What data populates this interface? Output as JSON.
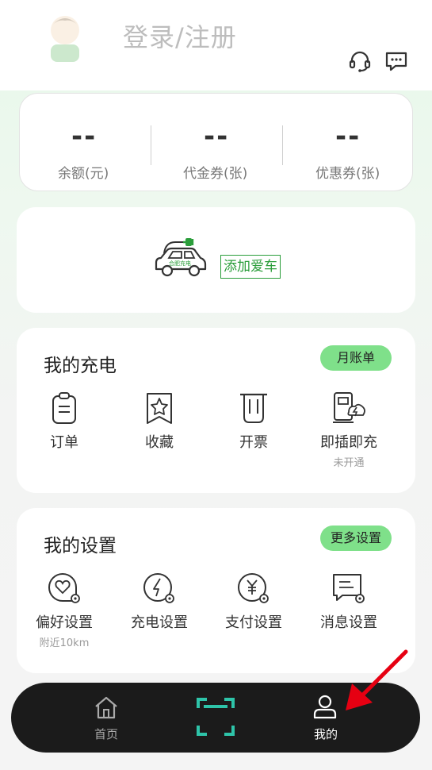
{
  "header": {
    "title": "登录/注册",
    "icons": [
      "customer-service-icon",
      "message-icon"
    ]
  },
  "stats": [
    {
      "value": "--",
      "label": "余额(元)"
    },
    {
      "value": "--",
      "label": "代金券(张)"
    },
    {
      "value": "--",
      "label": "优惠券(张)"
    }
  ],
  "car": {
    "add_label": "添加爱车",
    "car_text": "合肥充电"
  },
  "charging": {
    "title": "我的充电",
    "action": "月账单",
    "items": [
      {
        "label": "订单",
        "icon": "clipboard-icon"
      },
      {
        "label": "收藏",
        "icon": "favorite-star-icon"
      },
      {
        "label": "开票",
        "icon": "invoice-icon"
      },
      {
        "label": "即插即充",
        "sub": "未开通",
        "icon": "plug-charge-icon"
      }
    ]
  },
  "settings": {
    "title": "我的设置",
    "action": "更多设置",
    "items": [
      {
        "label": "偏好设置",
        "sub": "附近10km",
        "icon": "preference-settings-icon"
      },
      {
        "label": "充电设置",
        "icon": "charging-settings-icon"
      },
      {
        "label": "支付设置",
        "icon": "payment-settings-icon"
      },
      {
        "label": "消息设置",
        "icon": "message-settings-icon"
      }
    ]
  },
  "tabbar": {
    "home": "首页",
    "me": "我的"
  },
  "colors": {
    "accent": "#7fe08a",
    "brand_green": "#2a9d3a",
    "scan_teal": "#2ec4a9",
    "annotation_red": "#e60012"
  }
}
